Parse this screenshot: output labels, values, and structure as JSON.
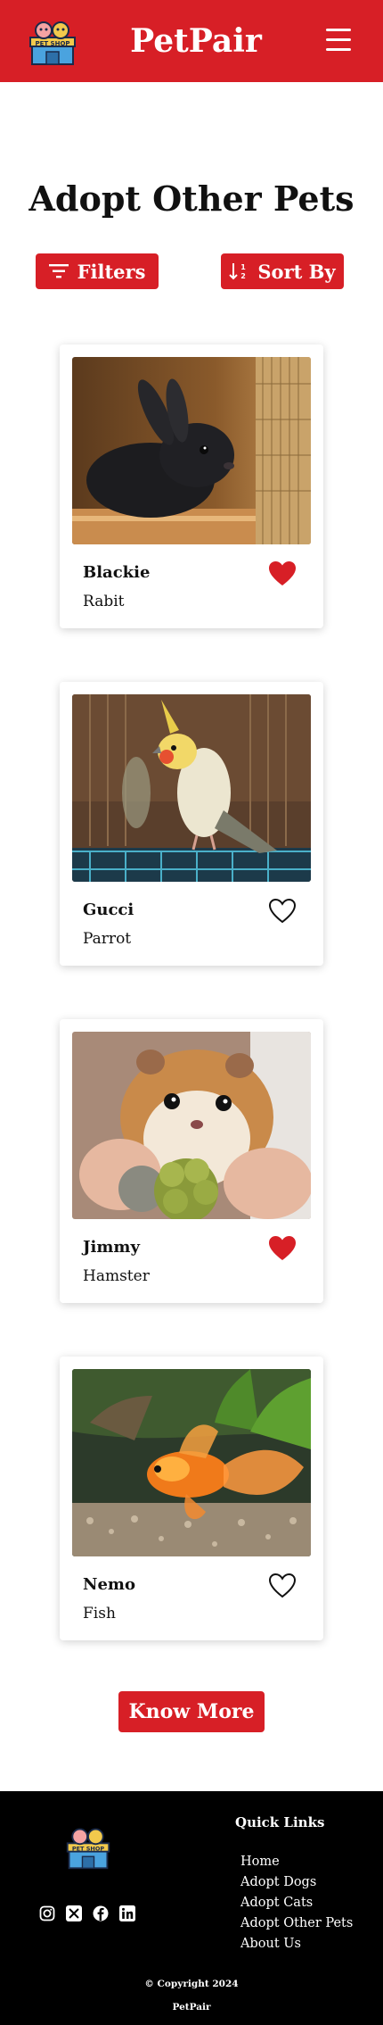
{
  "header": {
    "brand": "PetPair",
    "logo_text": "PET SHOP"
  },
  "page": {
    "title": "Adopt Other Pets"
  },
  "toolbar": {
    "filters_label": "Filters",
    "sort_label": "Sort By"
  },
  "pets": [
    {
      "name": "Blackie",
      "type": "Rabit",
      "favorited": true
    },
    {
      "name": "Gucci",
      "type": "Parrot",
      "favorited": false
    },
    {
      "name": "Jimmy",
      "type": "Hamster",
      "favorited": true
    },
    {
      "name": "Nemo",
      "type": "Fish",
      "favorited": false
    }
  ],
  "cta": {
    "know_more": "Know More"
  },
  "footer": {
    "logo_text": "PET SHOP",
    "quick_links_title": "Quick Links",
    "links": [
      "Home",
      "Adopt Dogs",
      "Adopt Cats",
      "Adopt Other Pets",
      "About Us"
    ],
    "copyright": "© Copyright  2024",
    "brand": "PetPair",
    "socials": [
      "instagram-icon",
      "x-icon",
      "facebook-icon",
      "linkedin-icon"
    ]
  },
  "colors": {
    "accent": "#d71f26",
    "footer_bg": "#000000",
    "heart": "#d71f26"
  }
}
